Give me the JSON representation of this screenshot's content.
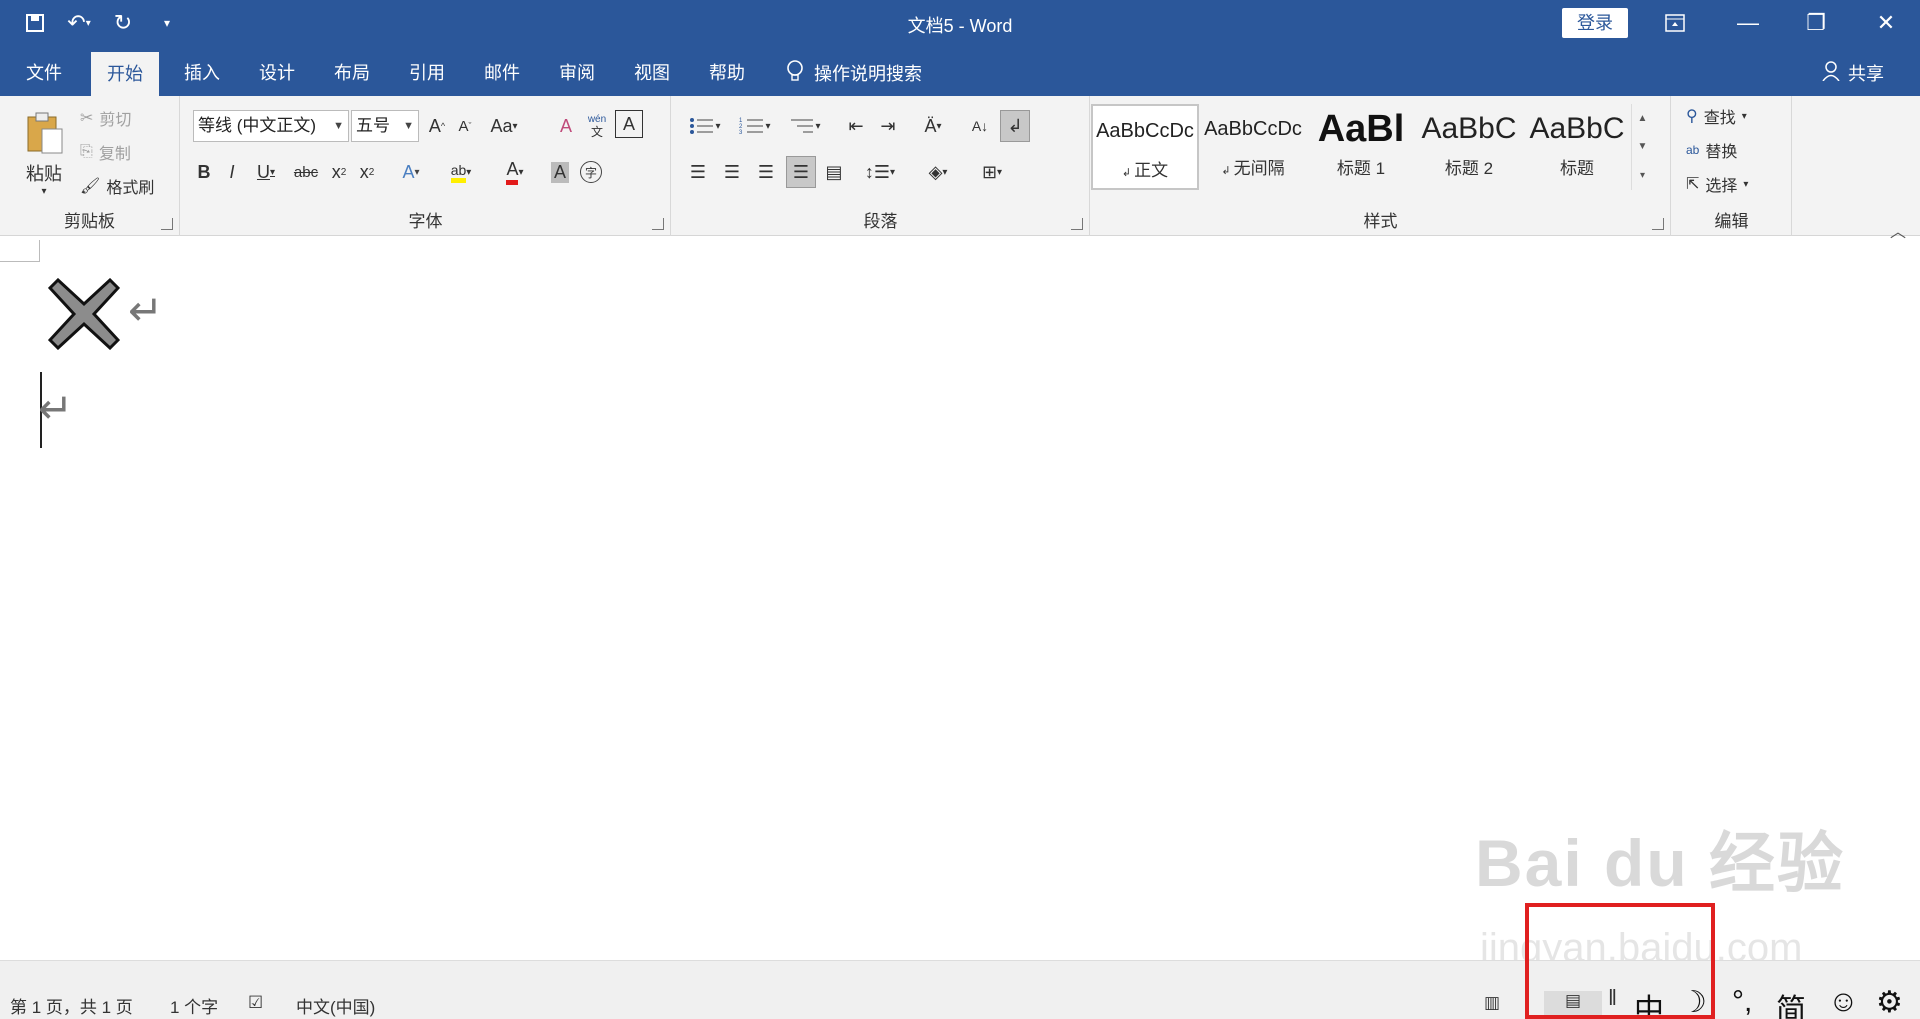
{
  "window": {
    "title": "文档5  -  Word",
    "login": "登录"
  },
  "tabs": [
    "文件",
    "开始",
    "插入",
    "设计",
    "布局",
    "引用",
    "邮件",
    "审阅",
    "视图",
    "帮助"
  ],
  "active_tab": "开始",
  "tell_me": "操作说明搜索",
  "share": "共享",
  "clipboard": {
    "paste": "粘贴",
    "cut": "剪切",
    "copy": "复制",
    "format_painter": "格式刷",
    "label": "剪贴板"
  },
  "font": {
    "name": "等线 (中文正文)",
    "size": "五号",
    "label": "字体"
  },
  "paragraph": {
    "label": "段落"
  },
  "styles": {
    "label": "样式",
    "items": [
      {
        "sample": "AaBbCcDc",
        "name": "正文"
      },
      {
        "sample": "AaBbCcDc",
        "name": "无间隔"
      },
      {
        "sample": "AaBl",
        "name": "标题 1"
      },
      {
        "sample": "AaBbC",
        "name": "标题 2"
      },
      {
        "sample": "AaBbC",
        "name": "标题"
      }
    ]
  },
  "editing": {
    "find": "查找",
    "replace": "替换",
    "select": "选择",
    "label": "编辑"
  },
  "status": {
    "page": "第 1 页，共 1 页",
    "words": "1 个字",
    "language": "中文(中国)"
  },
  "ime": {
    "mode": "中",
    "moon": "☽",
    "punct": "°,",
    "simp": "简",
    "smile": "☺",
    "gear": "⚙"
  },
  "watermark": {
    "main": "Bai du 经验",
    "sub": "jingyan.baidu.com"
  },
  "colors": {
    "brand": "#2b579a",
    "highlight_box": "#e02020"
  }
}
